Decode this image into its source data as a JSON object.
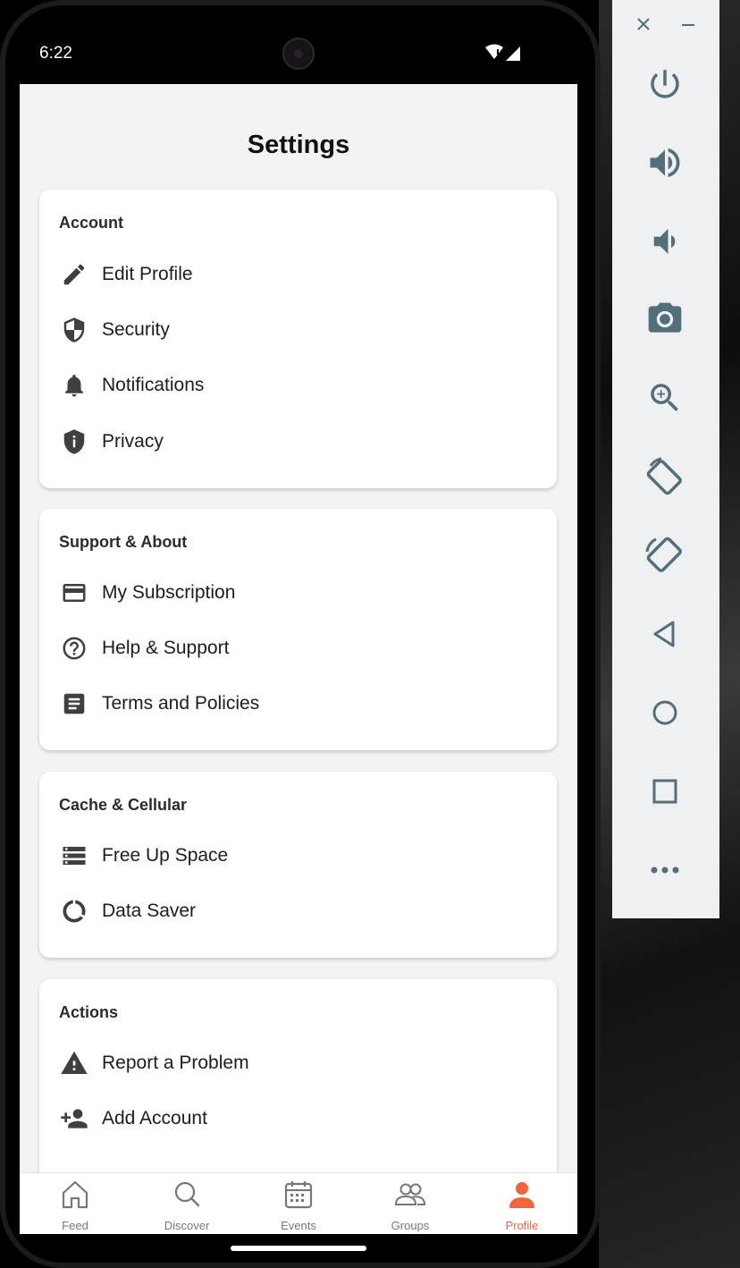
{
  "status": {
    "time": "6:22"
  },
  "screen": {
    "title": "Settings"
  },
  "sections": [
    {
      "title": "Account",
      "items": [
        {
          "label": "Edit Profile",
          "icon": "pencil-icon"
        },
        {
          "label": "Security",
          "icon": "shield-icon"
        },
        {
          "label": "Notifications",
          "icon": "bell-icon"
        },
        {
          "label": "Privacy",
          "icon": "shield-info-icon"
        }
      ]
    },
    {
      "title": "Support & About",
      "items": [
        {
          "label": "My Subscription",
          "icon": "credit-card-icon"
        },
        {
          "label": "Help & Support",
          "icon": "help-circle-icon"
        },
        {
          "label": "Terms and Policies",
          "icon": "document-icon"
        }
      ]
    },
    {
      "title": "Cache & Cellular",
      "items": [
        {
          "label": "Free Up Space",
          "icon": "storage-icon"
        },
        {
          "label": "Data Saver",
          "icon": "data-saver-icon"
        }
      ]
    },
    {
      "title": "Actions",
      "items": [
        {
          "label": "Report a Problem",
          "icon": "warning-icon"
        },
        {
          "label": "Add Account",
          "icon": "add-person-icon"
        }
      ]
    }
  ],
  "tabs": [
    {
      "label": "Feed",
      "icon": "home-icon"
    },
    {
      "label": "Discover",
      "icon": "search-icon"
    },
    {
      "label": "Events",
      "icon": "calendar-icon"
    },
    {
      "label": "Groups",
      "icon": "people-icon"
    },
    {
      "label": "Profile",
      "icon": "person-icon",
      "active": true
    }
  ],
  "colors": {
    "accent": "#f2643d",
    "icon": "#3f3f3f",
    "panel_icon": "#546e7a",
    "background": "#f3f3f3"
  },
  "emulator_panel": [
    "power-icon",
    "volume-up-icon",
    "volume-down-icon",
    "camera-icon",
    "zoom-icon",
    "rotate-left-icon",
    "rotate-right-icon",
    "back-icon",
    "home-circle-icon",
    "overview-icon",
    "more-icon"
  ]
}
